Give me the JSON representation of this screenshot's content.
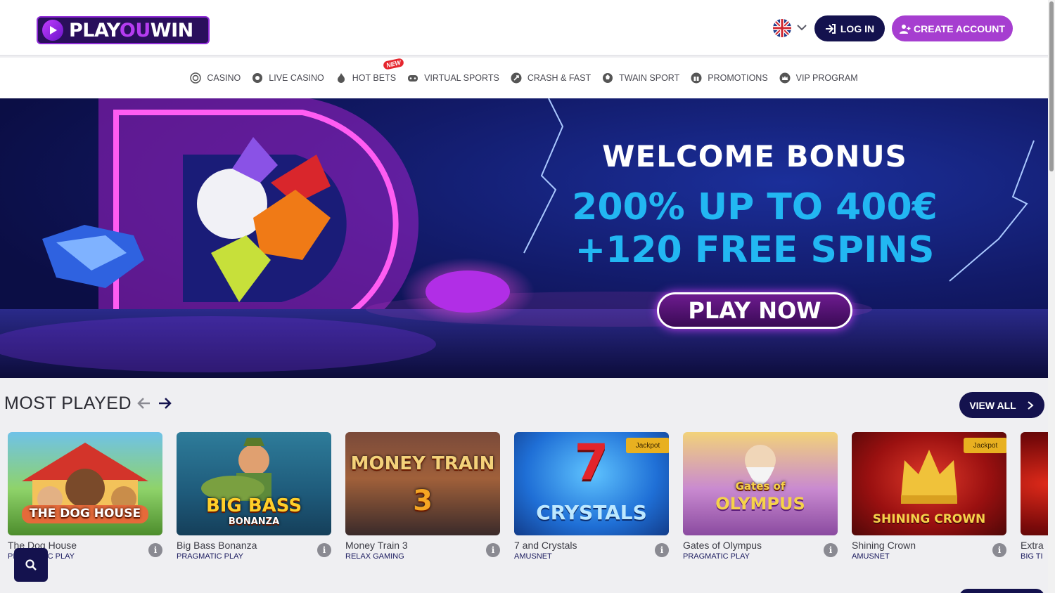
{
  "header": {
    "logo_text_a": "PLAY",
    "logo_text_b": "OU",
    "logo_text_c": "WIN",
    "login_label": "LOG IN",
    "create_label": "CREATE ACCOUNT",
    "language_icon": "uk-flag-icon"
  },
  "nav": {
    "items": [
      {
        "label": "CASINO",
        "icon": "casino-chip-icon"
      },
      {
        "label": "LIVE CASINO",
        "icon": "live-casino-icon"
      },
      {
        "label": "HOT BETS",
        "icon": "flame-icon",
        "badge": "NEW"
      },
      {
        "label": "VIRTUAL SPORTS",
        "icon": "gamepad-icon"
      },
      {
        "label": "CRASH & FAST",
        "icon": "rocket-icon"
      },
      {
        "label": "TWAIN SPORT",
        "icon": "ball-icon"
      },
      {
        "label": "PROMOTIONS",
        "icon": "gift-icon"
      },
      {
        "label": "VIP PROGRAM",
        "icon": "crown-icon"
      }
    ]
  },
  "banner": {
    "title": "WELCOME BONUS",
    "line2": "200% UP TO 400€",
    "line3": "+120 FREE SPINS",
    "cta": "PLAY NOW"
  },
  "most_played": {
    "title": "MOST PLAYED",
    "view_all": "VIEW ALL",
    "games": [
      {
        "name": "The Dog House",
        "provider": "PRAGMATIC PLAY",
        "thumb_text": "THE DOG HOUSE",
        "jackpot": ""
      },
      {
        "name": "Big Bass Bonanza",
        "provider": "PRAGMATIC PLAY",
        "thumb_text": "BIG BASS",
        "thumb_sub": "BONANZA",
        "jackpot": ""
      },
      {
        "name": "Money Train 3",
        "provider": "RELAX GAMING",
        "thumb_text": "MONEY TRAIN",
        "thumb_sub": "3",
        "jackpot": ""
      },
      {
        "name": "7 and Crystals",
        "provider": "AMUSNET",
        "thumb_text": "7",
        "thumb_sub": "CRYSTALS",
        "jackpot": "Jackpot"
      },
      {
        "name": "Gates of Olympus",
        "provider": "PRAGMATIC PLAY",
        "thumb_text": "Gates of",
        "thumb_sub": "OLYMPUS",
        "jackpot": ""
      },
      {
        "name": "Shining Crown",
        "provider": "AMUSNET",
        "thumb_text": "SHINING CROWN",
        "jackpot": "Jackpot"
      },
      {
        "name": "Extra",
        "provider": "BIG TI",
        "thumb_text": "",
        "jackpot": ""
      }
    ]
  },
  "colors": {
    "navy": "#14124e",
    "purple": "#a63ed0",
    "cyan": "#22b7f2",
    "jackpot": "#e8b020"
  }
}
